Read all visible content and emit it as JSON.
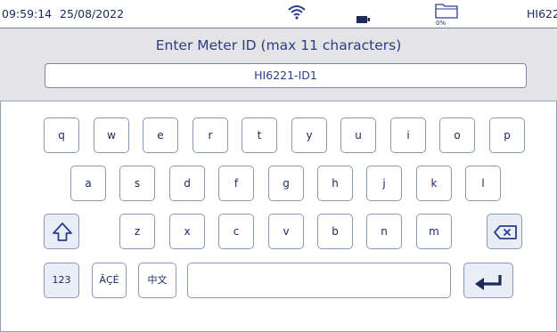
{
  "status_bar": {
    "time": "09:59:14",
    "date": "25/08/2022",
    "wifi_icon": "wifi-icon",
    "battery_icon": "battery-icon",
    "storage_icon": "folder-icon",
    "storage_percent": "0%",
    "model": "HI6221"
  },
  "header": {
    "title": "Enter Meter ID (max 11 characters)",
    "meter_id_value": "HI6221-ID1"
  },
  "keyboard": {
    "row1": [
      "q",
      "w",
      "e",
      "r",
      "t",
      "y",
      "u",
      "i",
      "o",
      "p"
    ],
    "row2": [
      "a",
      "s",
      "d",
      "f",
      "g",
      "h",
      "j",
      "k",
      "l"
    ],
    "row3": [
      "z",
      "x",
      "c",
      "v",
      "b",
      "n",
      "m"
    ],
    "shift_icon": "shift-arrow-icon",
    "backspace_icon": "backspace-icon",
    "numbers_label": "123",
    "accents_label": "ĂÇÉ",
    "chinese_label": "中文",
    "enter_icon": "enter-arrow-icon"
  },
  "colors": {
    "accent": "#2a3d8c",
    "header_bg": "#e4e4e6",
    "key_border": "#8a98b4"
  }
}
